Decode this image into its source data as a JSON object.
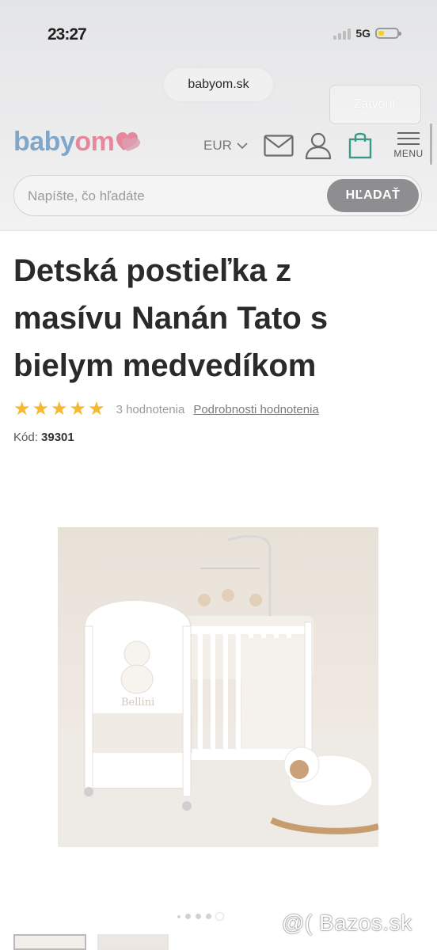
{
  "status_bar": {
    "time": "23:27",
    "network": "5G"
  },
  "browser": {
    "url": "babyom.sk",
    "close_label": "Zatvoriť"
  },
  "header": {
    "logo_part1": "baby",
    "logo_part2": "om",
    "currency": "EUR",
    "menu_label": "MENU"
  },
  "search": {
    "placeholder": "Napíšte, čo hľadáte",
    "button_label": "HĽADAŤ"
  },
  "product": {
    "title": "Detská postieľka z masívu Nanán Tato s bielym medvedíkom",
    "rating_stars": 5,
    "rating_count": "3 hodnotenia",
    "rating_details_link": "Podrobnosti hodnotenia",
    "code_label": "Kód:",
    "code_value": "39301",
    "image_headboard_text": "Bellini"
  },
  "gallery": {
    "dot_count": 5,
    "active_dot": 5
  },
  "watermark": "@( Bazos.sk",
  "colors": {
    "logo_blue": "#7fa7c9",
    "logo_pink": "#e8879c",
    "star": "#f5b82e",
    "search_button": "#8e8e90"
  }
}
